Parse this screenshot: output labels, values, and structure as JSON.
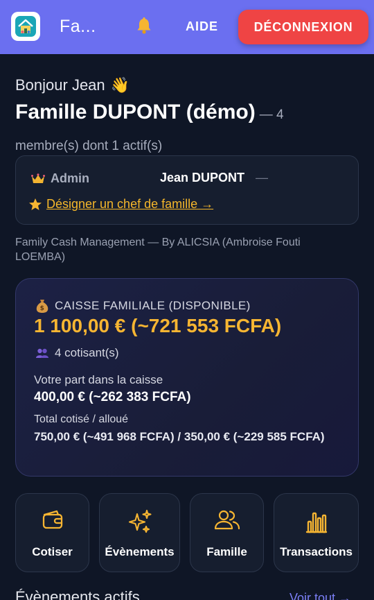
{
  "header": {
    "app_title": "Fa...",
    "logo_icon": "house-icon",
    "bell_icon": "bell-icon",
    "help_label": "AIDE",
    "logout_label": "DÉCONNEXION",
    "colors": {
      "bar": "#6b6ff0",
      "logout": "#ef4444"
    }
  },
  "greeting": {
    "text": "Bonjour Jean",
    "emoji": "👋"
  },
  "family": {
    "name": "Famille DUPONT (démo)",
    "dash": "— 4",
    "members_text": "membre(s) dont 1 actif(s)"
  },
  "admin_card": {
    "role_label": "Admin",
    "role_icon": "crown-icon",
    "admin_name": "Jean DUPONT",
    "dash": "—",
    "designate_icon": "star-icon",
    "designate_link": "Désigner un chef de famille →"
  },
  "credits": "Family Cash Management — By ALICSIA (Ambroise Fouti LOEMBA)",
  "caisse": {
    "icon": "money-bag-icon",
    "title": "CAISSE FAMILIALE (DISPONIBLE)",
    "amount": "1 100,00 € (~721 553 FCFA)",
    "cotisants_icon": "people-icon",
    "cotisants": "4 cotisant(s)",
    "part_label": "Votre part dans la caisse",
    "part_value": "400,00 € (~262 383 FCFA)",
    "total_label": "Total cotisé / alloué",
    "total_value": "750,00 € (~491 968 FCFA) / 350,00 € (~229 585 FCFA)",
    "accent": "#f6b532"
  },
  "quick_actions": [
    {
      "label": "Cotiser",
      "icon": "wallet-icon"
    },
    {
      "label": "Évènements",
      "icon": "sparkles-icon"
    },
    {
      "label": "Famille",
      "icon": "users-icon"
    },
    {
      "label": "Transactions",
      "icon": "bar-chart-icon"
    }
  ],
  "events": {
    "title": "Évènements actifs",
    "see_all": "Voir tout →"
  }
}
